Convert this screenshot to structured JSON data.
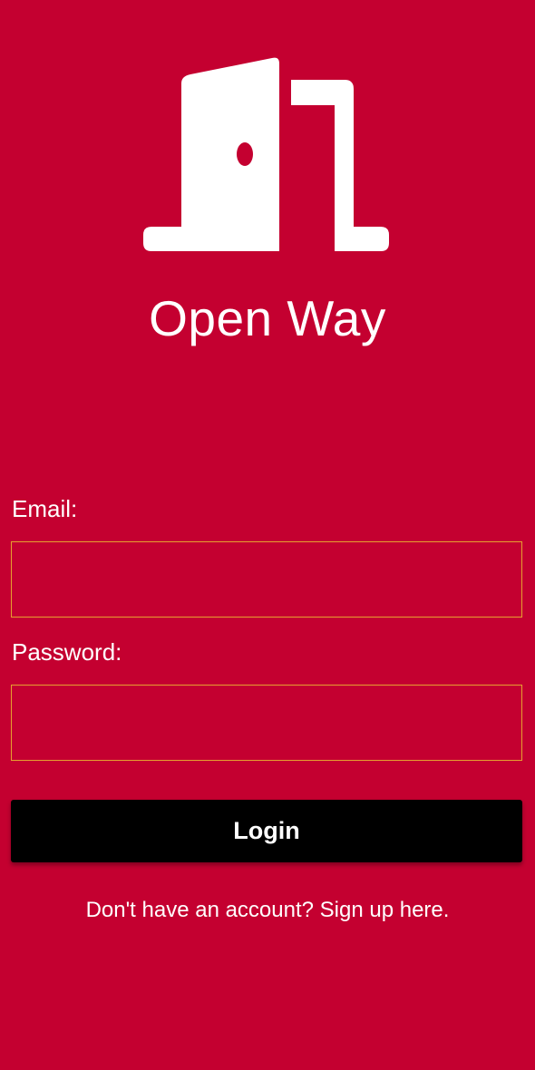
{
  "app": {
    "title": "Open Way",
    "logo_icon": "open-door-icon"
  },
  "form": {
    "email_label": "Email:",
    "email_value": "",
    "password_label": "Password:",
    "password_value": "",
    "login_label": "Login"
  },
  "footer": {
    "signup_text": "Don't have an account? Sign up here."
  },
  "colors": {
    "background": "#c40030",
    "input_border": "#e6a030",
    "button_background": "#000000",
    "text": "#ffffff"
  }
}
